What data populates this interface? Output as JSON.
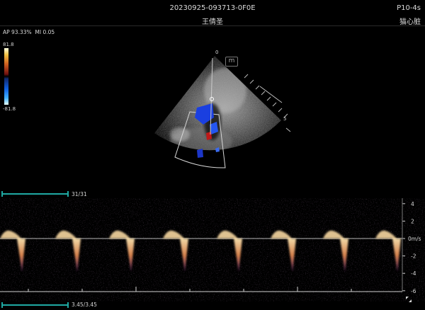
{
  "header": {
    "study_id": "20230925-093713-0F0E",
    "patient_name": "王倩圣",
    "probe": "P10-4s",
    "preset": "猫心脏"
  },
  "acquisition": {
    "ap": "AP 93.33%",
    "mi": "MI 0.05"
  },
  "color_map": {
    "max": "81.8",
    "min": "-81.8"
  },
  "image_marker": "m",
  "depth_marker": "5",
  "depth_top": "0",
  "doppler": {
    "frame_count": "31/31",
    "time": "3.45/3.45",
    "scale": [
      {
        "label": "4",
        "value": 4
      },
      {
        "label": "2",
        "value": 2
      },
      {
        "label": "0m/s",
        "value": 0
      },
      {
        "label": "-2",
        "value": -2
      },
      {
        "label": "-4",
        "value": -4
      },
      {
        "label": "-6",
        "value": -6
      }
    ]
  },
  "icons": {
    "zoom": "magnify-corner-icon"
  }
}
